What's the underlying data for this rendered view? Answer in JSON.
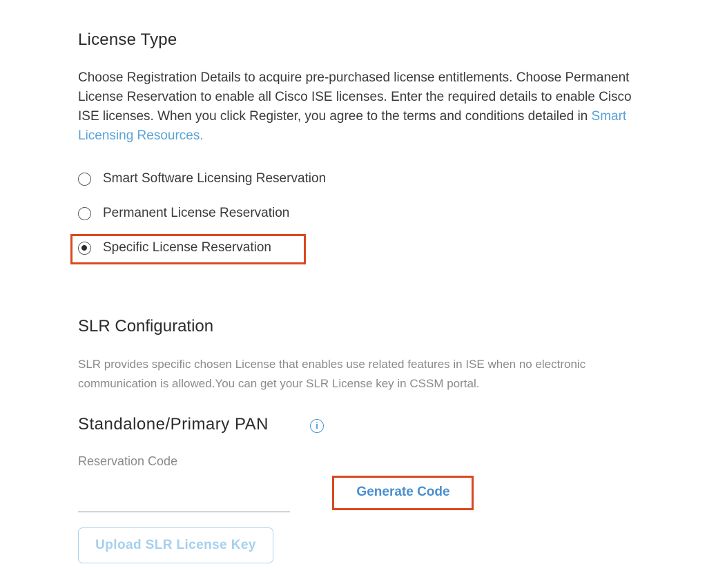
{
  "license_type": {
    "title": "License Type",
    "description": "Choose Registration Details to acquire pre-purchased license entitlements. Choose Permanent License Reservation to enable all Cisco ISE licenses. Enter the required details to enable Cisco ISE licenses. When you click Register, you agree to the terms and conditions detailed in ",
    "link_text": "Smart Licensing Resources.",
    "options": [
      {
        "label": "Smart Software Licensing Reservation",
        "checked": false
      },
      {
        "label": "Permanent License Reservation",
        "checked": false
      },
      {
        "label": "Specific License Reservation",
        "checked": true
      }
    ]
  },
  "slr": {
    "title": "SLR Configuration",
    "description": "SLR provides specific chosen License that enables use related features in ISE when no electronic communication is allowed.You can get your SLR License key in CSSM portal."
  },
  "pan": {
    "title": "Standalone/Primary PAN",
    "info_icon": "info-icon",
    "reservation_label": "Reservation Code",
    "reservation_value": "",
    "generate_button": "Generate Code",
    "upload_button": "Upload SLR License Key"
  },
  "colors": {
    "highlight": "#d9481f",
    "link": "#5aa2d8",
    "primary_text": "#3a3a3c",
    "muted_text": "#8a8a8c"
  }
}
